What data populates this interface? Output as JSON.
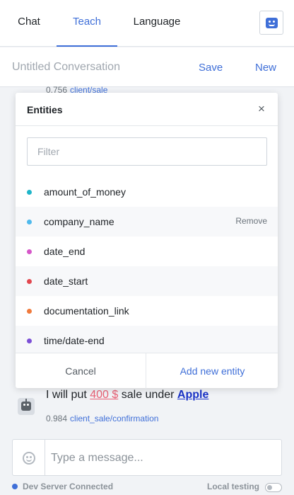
{
  "tabs": {
    "chat": "Chat",
    "teach": "Teach",
    "language": "Language",
    "active": "teach"
  },
  "header": {
    "title": "Untitled Conversation",
    "save_label": "Save",
    "new_label": "New"
  },
  "messages": [
    {
      "score": "0.756",
      "intent": "client/sale"
    },
    {
      "sender": "bot",
      "parts": {
        "before": "I will put ",
        "money": "400 $",
        "middle": " sale under ",
        "company": "Apple"
      },
      "score": "0.984",
      "intent": "client_sale/confirmation"
    }
  ],
  "composer": {
    "placeholder": "Type a message..."
  },
  "status": {
    "server": "Dev Server Connected",
    "local": "Local testing",
    "local_testing_enabled": false
  },
  "entities_popup": {
    "title": "Entities",
    "filter_placeholder": "Filter",
    "items": [
      {
        "name": "amount_of_money",
        "color": "#1fb5c9"
      },
      {
        "name": "company_name",
        "color": "#4fb9ec",
        "action": "Remove"
      },
      {
        "name": "date_end",
        "color": "#d657c9"
      },
      {
        "name": "date_start",
        "color": "#e2474f"
      },
      {
        "name": "documentation_link",
        "color": "#f07a3c"
      },
      {
        "name": "time/date-end",
        "color": "#7c4fd6"
      }
    ],
    "cancel_label": "Cancel",
    "add_label": "Add new entity"
  },
  "colors": {
    "accent": "#3f6fd8",
    "entity_money": "#e85f73",
    "entity_company": "#1a33c7"
  }
}
